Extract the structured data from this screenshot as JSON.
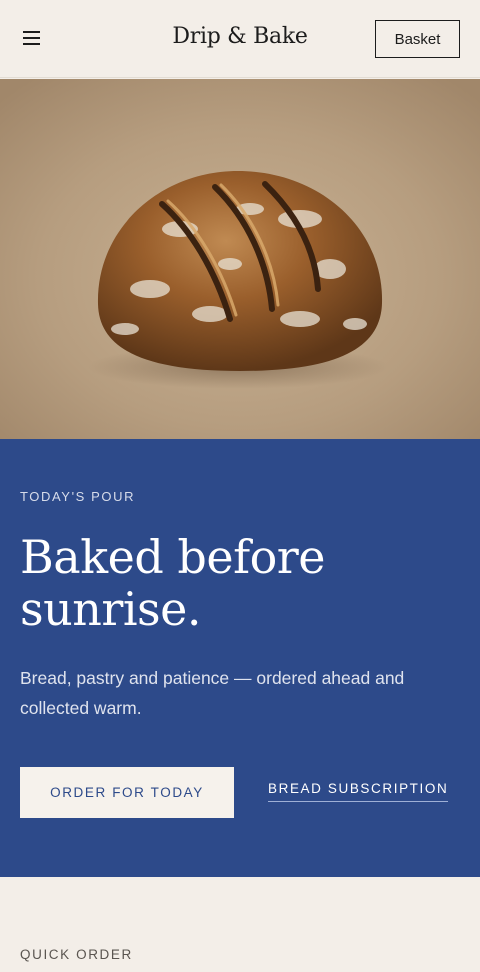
{
  "header": {
    "brand": "Drip & Bake",
    "basket_label": "Basket",
    "menu_icon": "hamburger-menu-icon"
  },
  "hero": {
    "image_subject": "round sourdough loaf on beige backdrop"
  },
  "promo": {
    "eyebrow": "TODAY'S POUR",
    "headline_line1": "Baked before",
    "headline_line2": "sunrise.",
    "subcopy": "Bread, pastry and patience — ordered ahead and collected warm.",
    "primary_cta": "ORDER FOR TODAY",
    "secondary_cta": "BREAD SUBSCRIPTION"
  },
  "quick_order": {
    "label": "QUICK ORDER"
  },
  "colors": {
    "page_bg": "#f3eee8",
    "promo_bg": "#2d4a8a",
    "text_dark": "#1c1c1c"
  }
}
